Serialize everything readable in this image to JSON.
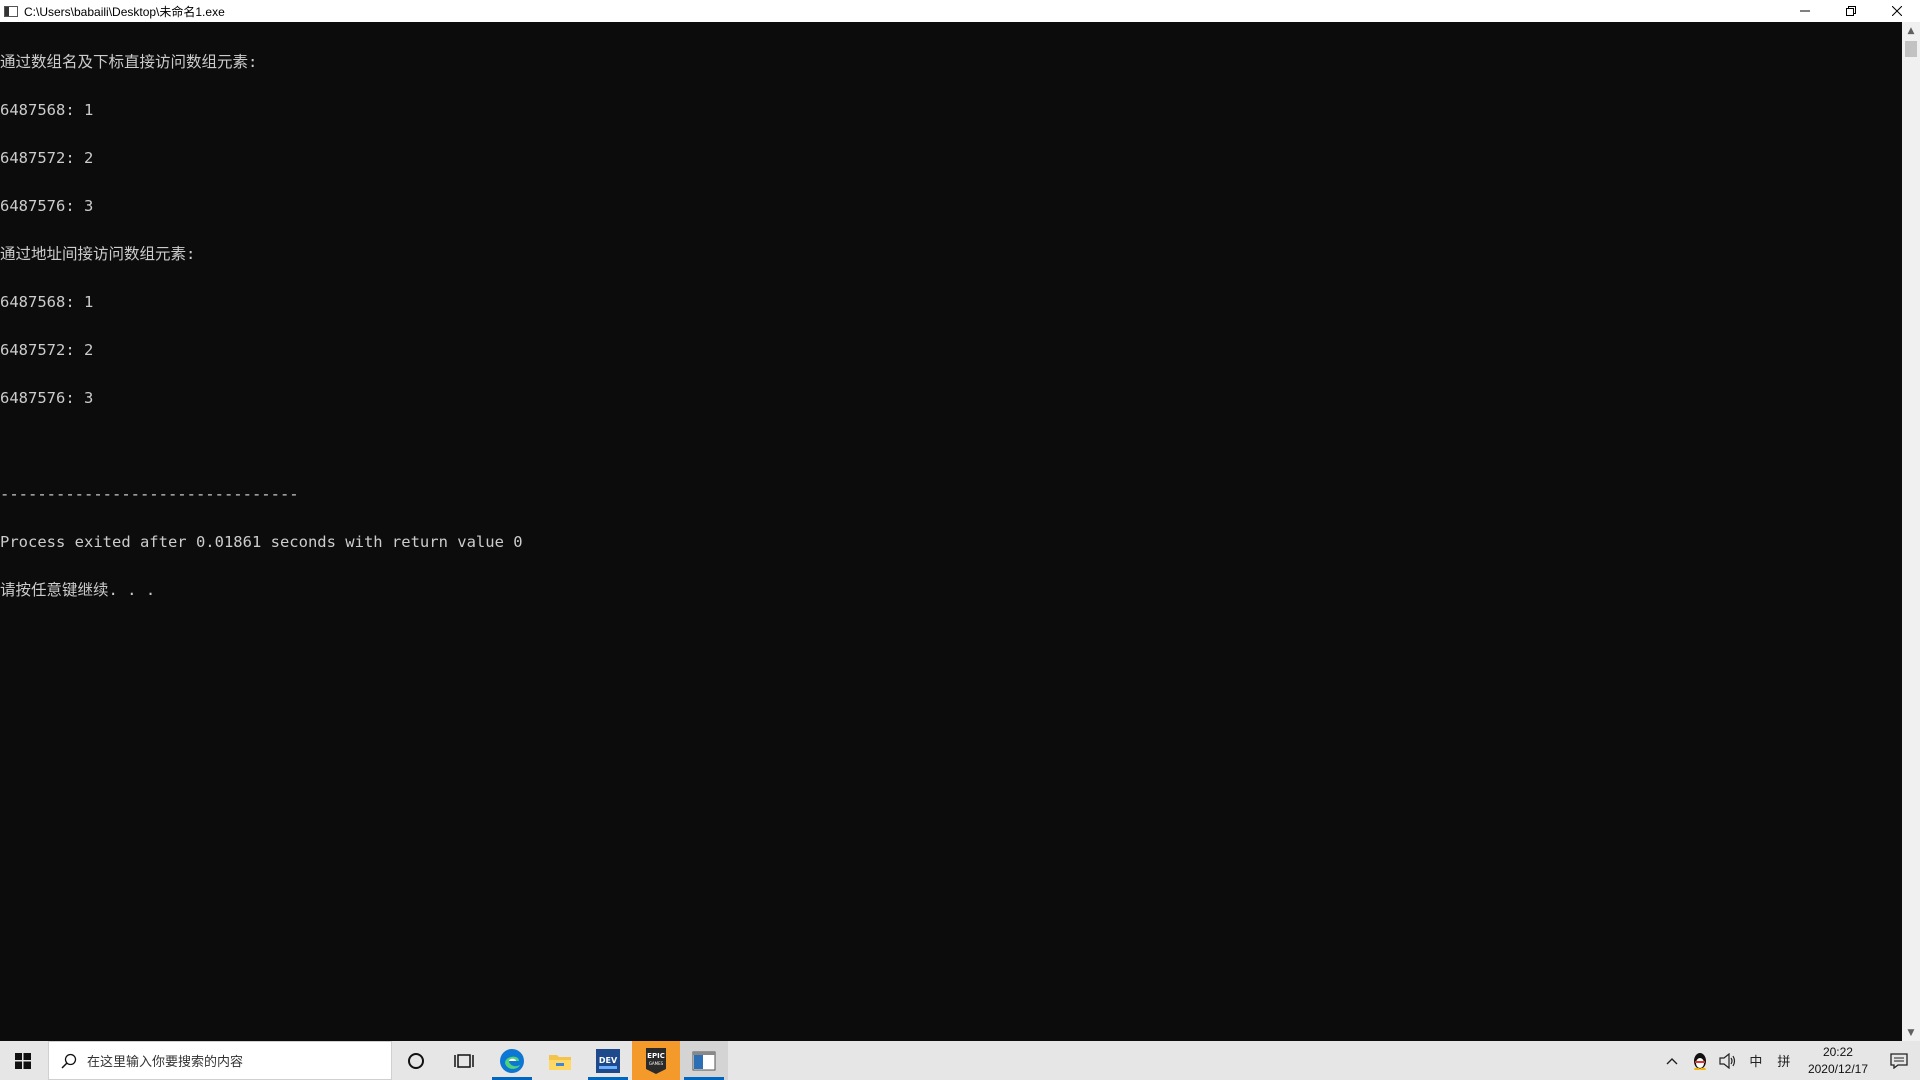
{
  "window": {
    "title": "C:\\Users\\babaili\\Desktop\\未命名1.exe",
    "controls": {
      "minimize": "—",
      "restore": "❐",
      "close": "✕"
    }
  },
  "console": {
    "lines": [
      "通过数组名及下标直接访问数组元素:",
      "6487568: 1",
      "6487572: 2",
      "6487576: 3",
      "通过地址间接访问数组元素:",
      "6487568: 1",
      "6487572: 2",
      "6487576: 3",
      "",
      "--------------------------------",
      "Process exited after 0.01861 seconds with return value 0",
      "请按任意键继续. . ."
    ]
  },
  "taskbar": {
    "search_placeholder": "在这里输入你要搜索的内容",
    "apps": [
      {
        "name": "cortana-icon"
      },
      {
        "name": "task-view-icon"
      },
      {
        "name": "edge-icon"
      },
      {
        "name": "file-explorer-icon"
      },
      {
        "name": "dev-cpp-icon"
      },
      {
        "name": "epic-games-icon"
      },
      {
        "name": "console-app-icon"
      }
    ],
    "tray": {
      "ime_lang": "中",
      "ime_mode": "拼"
    },
    "clock": {
      "time": "20:22",
      "date": "2020/12/17"
    }
  },
  "colors": {
    "console_bg": "#0c0c0c",
    "console_fg": "#cccccc",
    "taskbar_bg": "#e6e6e6",
    "accent": "#0067c0"
  }
}
